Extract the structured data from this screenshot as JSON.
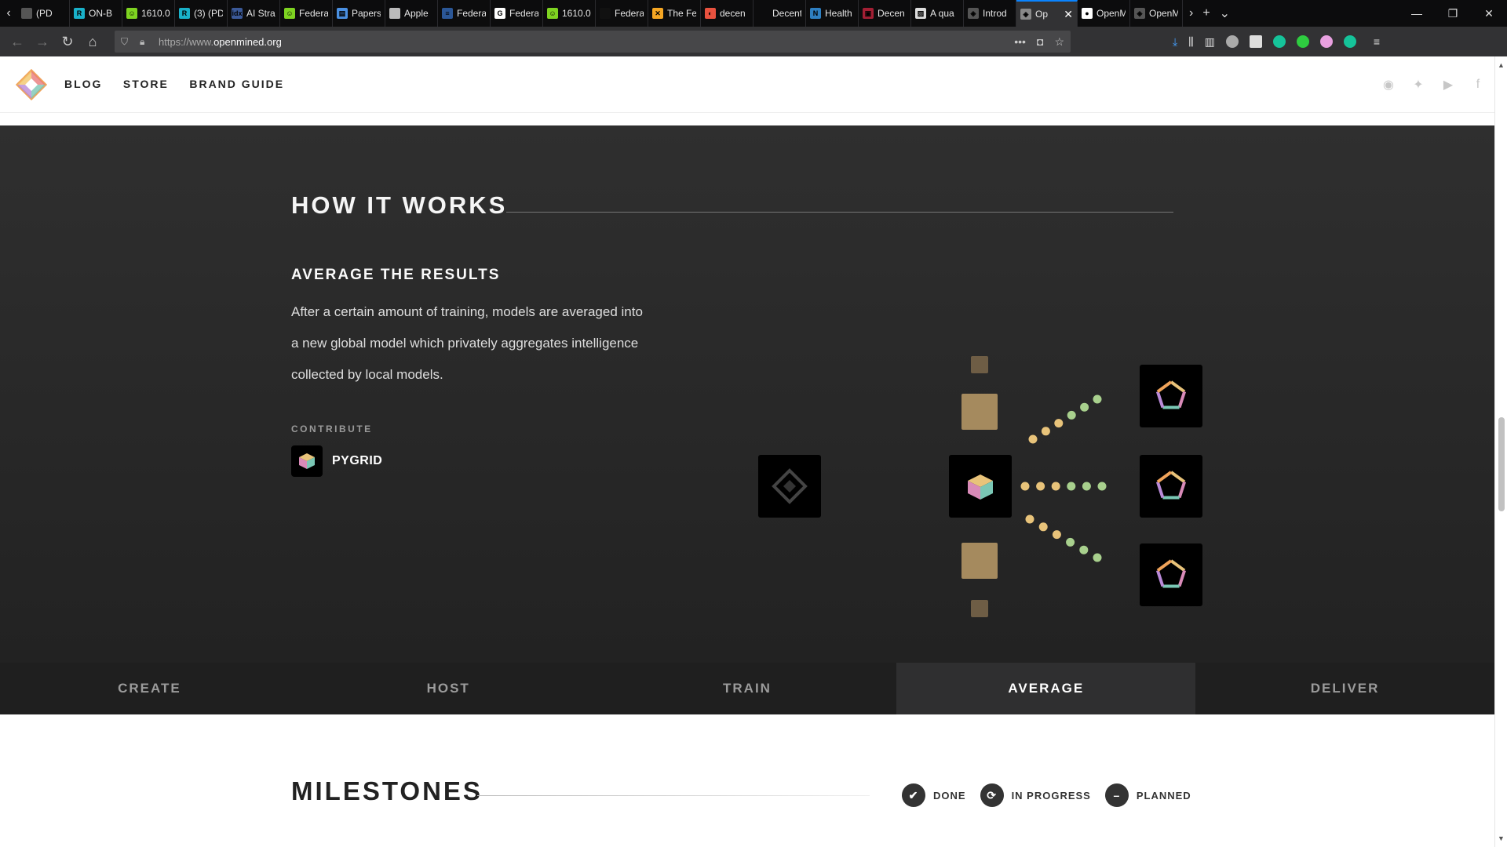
{
  "browser": {
    "tabs": [
      {
        "label": "(PD",
        "fav": "#555",
        "glyph": ""
      },
      {
        "label": "ON-B",
        "fav": "#19b1c9",
        "glyph": "R"
      },
      {
        "label": "1610.0",
        "fav": "#7ed321",
        "glyph": "☺"
      },
      {
        "label": "(3) (PD",
        "fav": "#19b1c9",
        "glyph": "R"
      },
      {
        "label": "AI Stra",
        "fav": "#3b5998",
        "glyph": "idx"
      },
      {
        "label": "Federa",
        "fav": "#7ed321",
        "glyph": "☺"
      },
      {
        "label": "Papers",
        "fav": "#4a90e2",
        "glyph": "▤"
      },
      {
        "label": "Apple",
        "fav": "#bbbbbb",
        "glyph": ""
      },
      {
        "label": "Federa",
        "fav": "#2b5797",
        "glyph": "≡"
      },
      {
        "label": "Federa",
        "fav": "#ffffff",
        "glyph": "G"
      },
      {
        "label": "1610.0",
        "fav": "#7ed321",
        "glyph": "☺"
      },
      {
        "label": "Federa",
        "fav": "#111111",
        "glyph": ""
      },
      {
        "label": "The Fe",
        "fav": "#f5a623",
        "glyph": "✕"
      },
      {
        "label": "decen",
        "fav": "#e8523f",
        "glyph": "◐"
      },
      {
        "label": "Decentraliz",
        "fav": "#0c0c0d",
        "glyph": ""
      },
      {
        "label": "Health",
        "fav": "#2e7fc1",
        "glyph": "N"
      },
      {
        "label": "Decen",
        "fav": "#a31f34",
        "glyph": "▣"
      },
      {
        "label": "A qua",
        "fav": "#dddddd",
        "glyph": "▨"
      },
      {
        "label": "Introd",
        "fav": "#555555",
        "glyph": "◈"
      },
      {
        "label": "Op",
        "fav": "#888888",
        "glyph": "◈",
        "active": true
      },
      {
        "label": "OpenM",
        "fav": "#ffffff",
        "glyph": "●"
      },
      {
        "label": "OpenM",
        "fav": "#555555",
        "glyph": "◈"
      }
    ],
    "url_prefix": "https://www.",
    "url_domain": "openmined.org"
  },
  "header": {
    "nav": [
      "BLOG",
      "STORE",
      "BRAND GUIDE"
    ],
    "social_icons": [
      "github-icon",
      "twitter-icon",
      "youtube-icon",
      "facebook-icon"
    ]
  },
  "how_it_works": {
    "title": "HOW IT WORKS",
    "step_title": "AVERAGE THE RESULTS",
    "description": "After a certain amount of training, models are averaged into a new global model which privately aggregates intelligence collected by local models.",
    "contribute_label": "CONTRIBUTE",
    "contribute_item": "PYGRID"
  },
  "step_tabs": [
    {
      "label": "CREATE",
      "active": false
    },
    {
      "label": "HOST",
      "active": false
    },
    {
      "label": "TRAIN",
      "active": false
    },
    {
      "label": "AVERAGE",
      "active": true
    },
    {
      "label": "DELIVER",
      "active": false
    }
  ],
  "milestones": {
    "title": "MILESTONES",
    "legend": [
      {
        "label": "DONE",
        "icon": "check-icon",
        "glyph": "✔"
      },
      {
        "label": "IN PROGRESS",
        "icon": "sync-icon",
        "glyph": "⟳"
      },
      {
        "label": "PLANNED",
        "icon": "minus-icon",
        "glyph": "–"
      }
    ]
  },
  "colors": {
    "dot_yellow": "#e8c37a",
    "dot_green": "#a8d08d",
    "tan": "#a58a5e",
    "tan_dark": "#6e5d45"
  }
}
